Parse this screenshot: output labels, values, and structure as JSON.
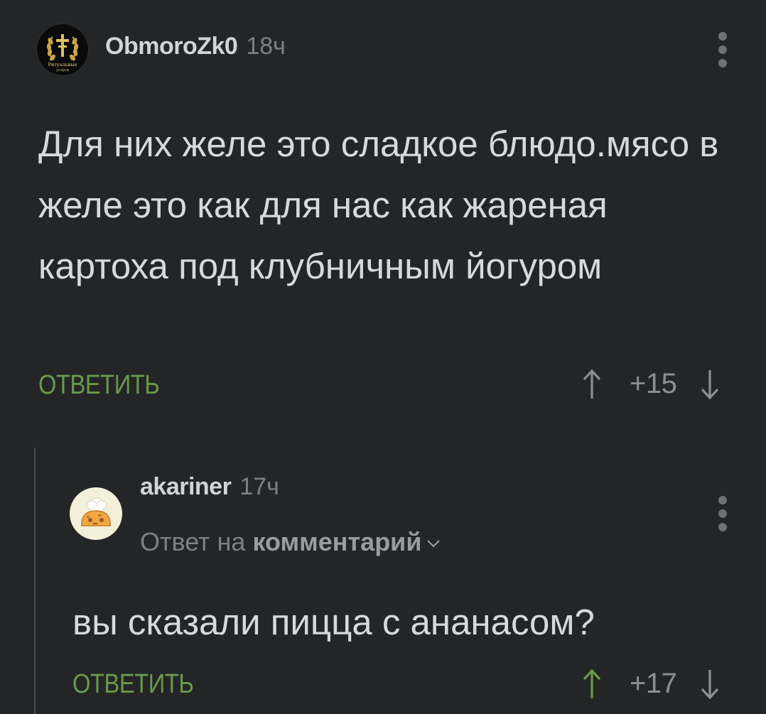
{
  "comment": {
    "username": "ObmoroZk0",
    "time": "18ч",
    "avatar_text": "Ритуальные услуги",
    "text": "Для них желе это сладкое блюдо.мясо в желе это как для нас как жареная картоха под клубничным йогуром",
    "reply_label": "ОТВЕТИТЬ",
    "score": "+15"
  },
  "reply": {
    "username": "akariner",
    "time": "17ч",
    "reply_prefix": "Ответ на",
    "reply_target": "комментарий",
    "text": "вы сказали пицца с ананасом?",
    "reply_label": "ОТВЕТИТЬ",
    "score": "+17"
  },
  "colors": {
    "background": "#232527",
    "accent_green": "#6a9a4a",
    "text": "#d8d9da",
    "muted": "#7d8184"
  },
  "icons": [
    "more-vertical-icon",
    "upvote-arrow-icon",
    "downvote-arrow-icon",
    "chevron-down-icon"
  ]
}
